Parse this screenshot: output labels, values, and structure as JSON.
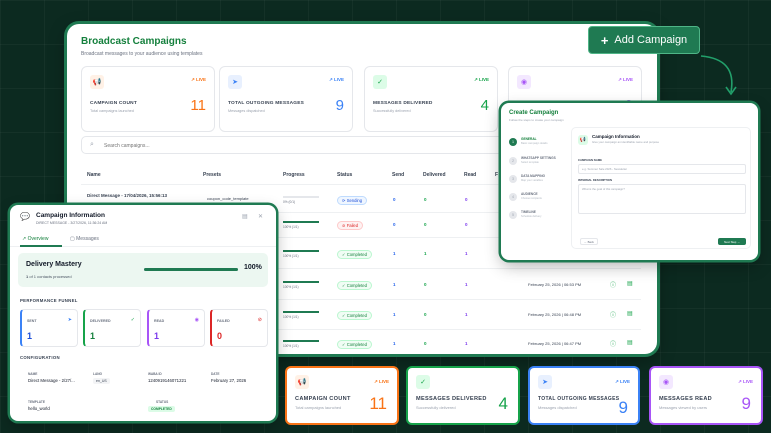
{
  "colors": {
    "brand": "#1f7a52",
    "orange": "#f97316",
    "blue": "#3b82f6",
    "green": "#16a34a",
    "purple": "#a855f7",
    "red": "#dc2626"
  },
  "header": {
    "title": "Broadcast Campaigns",
    "subtitle": "Broadcast messages to your audience using templates",
    "add_button": "Add Campaign"
  },
  "stats": [
    {
      "label": "CAMPAIGN COUNT",
      "desc": "Total campaigns launched",
      "live": "↗ LIVE",
      "value": "11",
      "icon": "megaphone-icon",
      "glyph": "📢"
    },
    {
      "label": "TOTAL OUTGOING MESSAGES",
      "desc": "Messages dispatched",
      "live": "↗ LIVE",
      "value": "9",
      "icon": "send-icon",
      "glyph": "➤"
    },
    {
      "label": "MESSAGES DELIVERED",
      "desc": "Successfully delivered",
      "live": "↗ LIVE",
      "value": "4",
      "icon": "check-circle-icon",
      "glyph": "✓"
    },
    {
      "label": "MESSAGES READ",
      "desc": "Messages viewed by users",
      "live": "↗ LIVE",
      "value": "9",
      "icon": "eye-icon",
      "glyph": "◉"
    }
  ],
  "search": {
    "placeholder": "Search campaigns..."
  },
  "table": {
    "headers": [
      "Name",
      "Presets",
      "Progress",
      "Status",
      "Send",
      "Delivered",
      "Read",
      "F"
    ],
    "rows": [
      {
        "name": "Direct Message - 17/04/2026, 15:56:13",
        "preset": "coupon_code_template",
        "progress": 0,
        "progress_label": "0% (0/1)",
        "status": "Sending",
        "send": "0",
        "delivered": "0",
        "read": "0",
        "date": ""
      },
      {
        "name": "",
        "preset": "",
        "progress": 100,
        "progress_label": "100% (1/1)",
        "status": "Failed",
        "send": "0",
        "delivered": "0",
        "read": "0",
        "date": ""
      },
      {
        "name": "",
        "preset": "",
        "progress": 100,
        "progress_label": "100% (1/1)",
        "status": "Completed",
        "send": "1",
        "delivered": "1",
        "read": "1",
        "date": ""
      },
      {
        "name": "",
        "preset": "",
        "progress": 100,
        "progress_label": "100% (1/1)",
        "status": "Completed",
        "send": "1",
        "delivered": "0",
        "read": "1",
        "date": "February 25, 2026 | 06:53 PM"
      },
      {
        "name": "",
        "preset": "",
        "progress": 100,
        "progress_label": "100% (1/1)",
        "status": "Completed",
        "send": "1",
        "delivered": "0",
        "read": "1",
        "date": "February 25, 2026 | 06:48 PM"
      },
      {
        "name": "",
        "preset": "",
        "progress": 100,
        "progress_label": "100% (1/1)",
        "status": "Completed",
        "send": "1",
        "delivered": "0",
        "read": "1",
        "date": "February 25, 2026 | 06:47 PM"
      }
    ]
  },
  "create_dialog": {
    "title": "Create Campaign",
    "subtitle": "Follow the steps to create your campaign",
    "steps": [
      {
        "label": "GENERAL",
        "desc": "Basic campaign details"
      },
      {
        "label": "WHATSAPP SETTINGS",
        "desc": "Select template"
      },
      {
        "label": "DATA MAPPING",
        "desc": "Map your variables"
      },
      {
        "label": "AUDIENCE",
        "desc": "Choose recipients"
      },
      {
        "label": "TIMELINE",
        "desc": "Schedule delivery"
      }
    ],
    "section_title": "Campaign Information",
    "section_sub": "Give your campaign an identifiable name and purpose",
    "name_label": "CAMPAIGN NAME",
    "name_value": "e.g. Summer Sale 2026 - Newsletter",
    "desc_label": "INTERNAL DESCRIPTION",
    "desc_placeholder": "What is the goal of this campaign?",
    "back": "← Back",
    "next": "Next Step →"
  },
  "info_panel": {
    "title": "Campaign Information",
    "subtitle": "DIRECT MESSAGE - 3/27/2026, 11:36:24 AM",
    "tabs": [
      "Overview",
      "Messages"
    ],
    "delivery_title": "Delivery Mastery",
    "delivery_count": "1",
    "delivery_text": "of 1 contacts processed",
    "delivery_pct": "100%",
    "delivery_value": 1.0,
    "funnel_title": "PERFORMANCE FUNNEL",
    "funnel": [
      {
        "label": "SENT",
        "value": "1",
        "color": "#3b82f6",
        "glyph": "➤"
      },
      {
        "label": "DELIVERED",
        "value": "1",
        "color": "#16a34a",
        "glyph": "✓"
      },
      {
        "label": "READ",
        "value": "1",
        "color": "#a855f7",
        "glyph": "◉"
      },
      {
        "label": "FAILED",
        "value": "0",
        "color": "#dc2626",
        "glyph": "⊘"
      }
    ],
    "config_title": "CONFIGURATION",
    "config": {
      "name_label": "NAME",
      "name_value": "Direct Message - 2/27/...",
      "lang_label": "LANG",
      "lang_value": "en_US",
      "waba_label": "WABA ID",
      "waba_value": "1240919146071221",
      "date_label": "DATE",
      "date_value": "February 27, 2026",
      "template_label": "TEMPLATE",
      "template_value": "hello_world",
      "status_label": "STATUS",
      "status_value": "COMPLETED"
    }
  }
}
